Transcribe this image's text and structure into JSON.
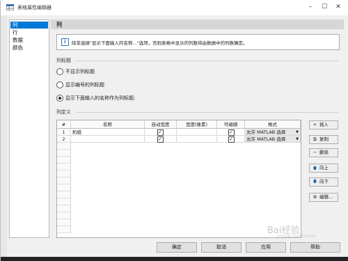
{
  "window": {
    "title": "表格属性编辑器"
  },
  "categories": [
    {
      "label": "列",
      "selected": true
    },
    {
      "label": "行"
    },
    {
      "label": "数据"
    },
    {
      "label": "颜色"
    }
  ],
  "section_header": "列",
  "info_text": "除非选择\"显示下面输入的名称...\"选项，否则表格中显示的列数将由数据中的列数确定。",
  "column_header_group": {
    "label": "列标题",
    "options": [
      {
        "label": "不显示列标题",
        "checked": false
      },
      {
        "label": "显示编号的列标题",
        "checked": false
      },
      {
        "label": "显示下面输入的名称作为列标题:",
        "checked": true
      }
    ]
  },
  "column_definition": {
    "label": "列定义",
    "headers": [
      "#",
      "名称",
      "自动宽度",
      "宽度(像素)",
      "可编辑",
      "格式"
    ],
    "rows": [
      {
        "index": "1",
        "name": "机组",
        "auto_width": true,
        "width": "",
        "editable": true,
        "format": "允许 MATLAB 选择"
      },
      {
        "index": "2",
        "name": "",
        "auto_width": true,
        "width": "",
        "editable": true,
        "format": "允许 MATLAB 选择"
      }
    ]
  },
  "side_buttons": [
    {
      "label": "插入",
      "icon": "plus-icon"
    },
    {
      "label": "复制",
      "icon": "copy-icon"
    },
    {
      "label": "删除",
      "icon": "minus-icon"
    },
    {
      "label": "向上",
      "icon": "arrow-up-icon"
    },
    {
      "label": "向下",
      "icon": "arrow-down-icon"
    },
    {
      "label": "编辑...",
      "icon": "edit-icon"
    }
  ],
  "footer_buttons": {
    "ok": "确定",
    "cancel": "取消",
    "apply": "应用",
    "help": "帮助"
  },
  "watermark": {
    "text": "Bai经验",
    "sub": "jingyan.baidu.com"
  },
  "colors": {
    "accent": "#0078d7",
    "header_bg": "#d6d6d6",
    "dialog_bg": "#f0f0f0"
  }
}
